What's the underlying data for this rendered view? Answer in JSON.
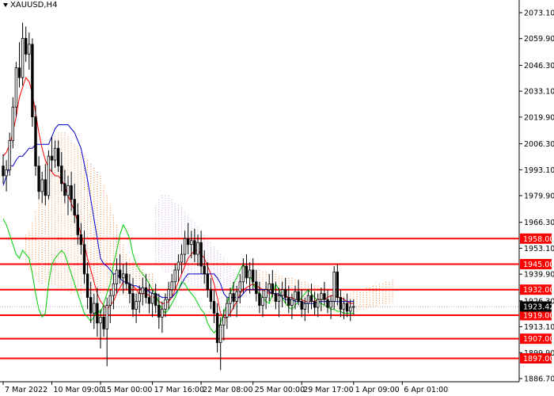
{
  "chart_data": {
    "type": "candlestick",
    "title": "XAUUSD,H4",
    "ylim": [
      1886.7,
      2080
    ],
    "y_ticks": [
      "2073.10",
      "2059.90",
      "2046.30",
      "2033.10",
      "2019.90",
      "2006.30",
      "1993.10",
      "1979.90",
      "1966.30",
      "1953.10",
      "1939.90",
      "1926.30",
      "1913.10",
      "1899.90",
      "1886.70"
    ],
    "x_ticks": [
      {
        "label": "7 Mar 2022",
        "index": 0
      },
      {
        "label": "10 Mar 09:00",
        "index": 15
      },
      {
        "label": "15 Mar 00:00",
        "index": 30
      },
      {
        "label": "17 Mar 16:00",
        "index": 46
      },
      {
        "label": "22 Mar 08:00",
        "index": 61
      },
      {
        "label": "25 Mar 00:00",
        "index": 77
      },
      {
        "label": "29 Mar 17:00",
        "index": 92
      },
      {
        "label": "1 Apr 09:00",
        "index": 108
      },
      {
        "label": "6 Apr 01:00",
        "index": 123
      }
    ],
    "horizontal_levels": [
      {
        "label": "1958.00",
        "value": 1958.0,
        "color": "#ff0000"
      },
      {
        "label": "1945.00",
        "value": 1945.0,
        "color": "#ff0000"
      },
      {
        "label": "1932.00",
        "value": 1932.0,
        "color": "#ff0000"
      },
      {
        "label": "1919.00",
        "value": 1919.0,
        "color": "#ff0000"
      },
      {
        "label": "1907.00",
        "value": 1907.0,
        "color": "#ff0000"
      },
      {
        "label": "1897.00",
        "value": 1897.0,
        "color": "#ff0000"
      }
    ],
    "current_price": {
      "label": "1923.42",
      "value": 1923.42
    },
    "candles": [
      [
        1995,
        2001,
        1986,
        1990
      ],
      [
        1990,
        1998,
        1982,
        1993
      ],
      [
        1993,
        2012,
        1990,
        2008
      ],
      [
        2008,
        2030,
        2004,
        2025
      ],
      [
        2025,
        2048,
        2020,
        2045
      ],
      [
        2045,
        2058,
        2035,
        2040
      ],
      [
        2040,
        2068,
        2036,
        2060
      ],
      [
        2060,
        2066,
        2048,
        2052
      ],
      [
        2052,
        2063,
        2044,
        2057
      ],
      [
        2057,
        2060,
        2015,
        2020
      ],
      [
        2020,
        2026,
        1990,
        1995
      ],
      [
        1995,
        2000,
        1978,
        1982
      ],
      [
        1982,
        1992,
        1976,
        1988
      ],
      [
        1988,
        1996,
        1975,
        1980
      ],
      [
        1980,
        2003,
        1978,
        2000
      ],
      [
        2000,
        2010,
        1992,
        1998
      ],
      [
        1998,
        2008,
        1994,
        2004
      ],
      [
        2004,
        2008,
        1992,
        1995
      ],
      [
        1995,
        2002,
        1982,
        1986
      ],
      [
        1986,
        1993,
        1976,
        1980
      ],
      [
        1980,
        1990,
        1970,
        1985
      ],
      [
        1985,
        1992,
        1972,
        1978
      ],
      [
        1978,
        1986,
        1966,
        1970
      ],
      [
        1970,
        1976,
        1955,
        1960
      ],
      [
        1960,
        1966,
        1950,
        1955
      ],
      [
        1955,
        1962,
        1935,
        1940
      ],
      [
        1940,
        1946,
        1922,
        1928
      ],
      [
        1928,
        1936,
        1915,
        1920
      ],
      [
        1920,
        1930,
        1912,
        1925
      ],
      [
        1925,
        1933,
        1908,
        1915
      ],
      [
        1915,
        1922,
        1902,
        1918
      ],
      [
        1918,
        1924,
        1908,
        1912
      ],
      [
        1912,
        1928,
        1893,
        1924
      ],
      [
        1924,
        1932,
        1915,
        1929
      ],
      [
        1929,
        1940,
        1922,
        1935
      ],
      [
        1935,
        1948,
        1930,
        1942
      ],
      [
        1942,
        1950,
        1935,
        1938
      ],
      [
        1938,
        1945,
        1930,
        1940
      ],
      [
        1940,
        1946,
        1932,
        1935
      ],
      [
        1935,
        1940,
        1925,
        1930
      ],
      [
        1930,
        1938,
        1918,
        1922
      ],
      [
        1922,
        1930,
        1915,
        1926
      ],
      [
        1926,
        1934,
        1920,
        1930
      ],
      [
        1930,
        1938,
        1924,
        1933
      ],
      [
        1933,
        1940,
        1925,
        1928
      ],
      [
        1928,
        1935,
        1920,
        1925
      ],
      [
        1925,
        1932,
        1918,
        1930
      ],
      [
        1930,
        1935,
        1920,
        1924
      ],
      [
        1924,
        1930,
        1912,
        1918
      ],
      [
        1918,
        1926,
        1910,
        1922
      ],
      [
        1922,
        1930,
        1918,
        1927
      ],
      [
        1927,
        1936,
        1922,
        1932
      ],
      [
        1932,
        1940,
        1928,
        1936
      ],
      [
        1936,
        1945,
        1932,
        1942
      ],
      [
        1942,
        1950,
        1936,
        1946
      ],
      [
        1946,
        1955,
        1940,
        1950
      ],
      [
        1950,
        1962,
        1945,
        1958
      ],
      [
        1958,
        1966,
        1950,
        1955
      ],
      [
        1955,
        1962,
        1948,
        1957
      ],
      [
        1957,
        1963,
        1946,
        1950
      ],
      [
        1950,
        1960,
        1944,
        1956
      ],
      [
        1956,
        1962,
        1940,
        1944
      ],
      [
        1944,
        1952,
        1935,
        1940
      ],
      [
        1940,
        1946,
        1928,
        1932
      ],
      [
        1932,
        1938,
        1922,
        1926
      ],
      [
        1926,
        1932,
        1915,
        1920
      ],
      [
        1920,
        1925,
        1900,
        1905
      ],
      [
        1905,
        1918,
        1891,
        1914
      ],
      [
        1914,
        1922,
        1906,
        1918
      ],
      [
        1918,
        1928,
        1912,
        1925
      ],
      [
        1925,
        1933,
        1918,
        1930
      ],
      [
        1930,
        1936,
        1922,
        1926
      ],
      [
        1926,
        1934,
        1918,
        1931
      ],
      [
        1931,
        1940,
        1925,
        1936
      ],
      [
        1936,
        1948,
        1930,
        1944
      ],
      [
        1944,
        1950,
        1935,
        1938
      ],
      [
        1938,
        1946,
        1930,
        1942
      ],
      [
        1942,
        1948,
        1932,
        1936
      ],
      [
        1936,
        1942,
        1926,
        1930
      ],
      [
        1930,
        1936,
        1920,
        1924
      ],
      [
        1924,
        1932,
        1918,
        1928
      ],
      [
        1928,
        1936,
        1922,
        1932
      ],
      [
        1932,
        1940,
        1926,
        1935
      ],
      [
        1935,
        1942,
        1928,
        1930
      ],
      [
        1930,
        1936,
        1922,
        1926
      ],
      [
        1926,
        1933,
        1918,
        1929
      ],
      [
        1929,
        1936,
        1923,
        1932
      ],
      [
        1932,
        1938,
        1925,
        1928
      ],
      [
        1928,
        1934,
        1920,
        1924
      ],
      [
        1924,
        1930,
        1917,
        1927
      ],
      [
        1927,
        1934,
        1922,
        1931
      ],
      [
        1931,
        1937,
        1924,
        1926
      ],
      [
        1926,
        1932,
        1918,
        1922
      ],
      [
        1922,
        1928,
        1916,
        1925
      ],
      [
        1925,
        1932,
        1920,
        1929
      ],
      [
        1929,
        1935,
        1922,
        1926
      ],
      [
        1926,
        1931,
        1919,
        1923
      ],
      [
        1923,
        1930,
        1918,
        1927
      ],
      [
        1927,
        1933,
        1921,
        1930
      ],
      [
        1930,
        1936,
        1924,
        1927
      ],
      [
        1927,
        1932,
        1920,
        1923
      ],
      [
        1923,
        1929,
        1917,
        1926
      ],
      [
        1926,
        1944,
        1922,
        1941
      ],
      [
        1941,
        1945,
        1924,
        1928
      ],
      [
        1928,
        1932,
        1918,
        1922
      ],
      [
        1922,
        1928,
        1917,
        1925
      ],
      [
        1925,
        1930,
        1918,
        1921
      ],
      [
        1921,
        1927,
        1916,
        1923
      ],
      [
        1923,
        1927,
        1919,
        1923.42
      ]
    ],
    "lines": [
      {
        "color": "#ff0000",
        "values": [
          2000,
          2002,
          2006,
          2012,
          2020,
          2030,
          2035,
          2040,
          2038,
          2032,
          2022,
          2012,
          2004,
          1998,
          1994,
          1992,
          1990,
          1990,
          1988,
          1985,
          1980,
          1976,
          1972,
          1966,
          1960,
          1955,
          1948,
          1942,
          1936,
          1930,
          1926,
          1924,
          1922,
          1924,
          1926,
          1930,
          1933,
          1936,
          1936,
          1935,
          1934,
          1932,
          1930,
          1930,
          1930,
          1929,
          1928,
          1928,
          1926,
          1925,
          1925,
          1926,
          1928,
          1932,
          1936,
          1940,
          1944,
          1948,
          1950,
          1952,
          1952,
          1950,
          1948,
          1944,
          1940,
          1935,
          1928,
          1920,
          1917,
          1918,
          1920,
          1923,
          1926,
          1930,
          1932,
          1933,
          1934,
          1935,
          1934,
          1933,
          1932,
          1931,
          1930,
          1930,
          1930,
          1929,
          1929,
          1929,
          1928,
          1928,
          1927,
          1927,
          1927,
          1926,
          1926,
          1926,
          1926,
          1927,
          1927,
          1927,
          1928,
          1929,
          1929,
          1928,
          1928,
          1927,
          1926,
          1925,
          1925
        ]
      },
      {
        "color": "#0000cc",
        "values": [
          1985,
          1990,
          1995,
          1995,
          1998,
          2000,
          2000,
          2002,
          2004,
          2004,
          2006,
          2006,
          2006,
          2006,
          2006,
          2010,
          2014,
          2016,
          2016,
          2016,
          2016,
          2014,
          2012,
          2008,
          2004,
          1996,
          1988,
          1978,
          1968,
          1958,
          1948,
          1945,
          1944,
          1942,
          1940,
          1940,
          1938,
          1936,
          1936,
          1935,
          1934,
          1934,
          1933,
          1932,
          1932,
          1931,
          1930,
          1930,
          1929,
          1928,
          1928,
          1928,
          1928,
          1930,
          1932,
          1935,
          1938,
          1940,
          1940,
          1940,
          1940,
          1940,
          1940,
          1940,
          1940,
          1940,
          1938,
          1935,
          1930,
          1928,
          1928,
          1928,
          1928,
          1928,
          1930,
          1932,
          1932,
          1932,
          1932,
          1932,
          1932,
          1932,
          1931,
          1930,
          1930,
          1930,
          1928,
          1927,
          1927,
          1927,
          1926,
          1926,
          1926,
          1925,
          1925,
          1925,
          1925,
          1926,
          1926,
          1926,
          1926,
          1926,
          1926,
          1926,
          1926,
          1926,
          1926,
          1926,
          1926
        ]
      },
      {
        "color": "#00cc00",
        "values": [
          1968,
          1965,
          1960,
          1955,
          1950,
          1948,
          1952,
          1950,
          1948,
          1940,
          1930,
          1922,
          1918,
          1920,
          1935,
          1945,
          1948,
          1950,
          1952,
          1950,
          1945,
          1940,
          1935,
          1930,
          1925,
          1920,
          1918,
          1916,
          1918,
          1922,
          1920,
          1925,
          1930,
          1935,
          1945,
          1952,
          1960,
          1965,
          1962,
          1958,
          1950,
          1945,
          1942,
          1940,
          1938,
          1935,
          1932,
          1930,
          1925,
          1922,
          1920,
          1922,
          1925,
          1928,
          1932,
          1936,
          1935,
          1932,
          1930,
          1928,
          1925,
          1922,
          1920,
          1915,
          1912,
          1910,
          1912,
          1915,
          1920,
          1925,
          1930,
          1935,
          1938,
          1942,
          1945,
          1942,
          1940,
          1935,
          1932,
          1930,
          1928,
          1926,
          1925,
          1930,
          1935,
          1932,
          1928,
          1925,
          1923,
          1922,
          1924,
          1926,
          1928,
          1930,
          1932,
          1930,
          1928,
          1926,
          1925,
          1924,
          1923,
          1922,
          1922,
          1921,
          1921,
          1920,
          1920,
          1920,
          1920
        ]
      }
    ],
    "clouds": [
      {
        "color": "#f08030",
        "start": 7,
        "values_a": [
          1960,
          1962,
          1966,
          1972,
          1980,
          1990,
          1998,
          2004,
          2008,
          2010,
          2012,
          2012,
          2012,
          2010,
          2008,
          2006,
          2004,
          2002,
          2000,
          1998,
          1996,
          1994,
          1992,
          1990,
          1985,
          1980,
          1975,
          1970,
          1965,
          1960,
          1955,
          1950,
          1948,
          1946,
          1944,
          1944,
          1942,
          1940,
          1940,
          1940
        ],
        "values_b": [
          1945,
          1942,
          1940,
          1938,
          1935,
          1935,
          1935,
          1934,
          1934,
          1934,
          1933,
          1932,
          1932,
          1931,
          1930,
          1930,
          1930,
          1930,
          1930,
          1930,
          1930,
          1930,
          1930,
          1930,
          1930,
          1929,
          1929,
          1929,
          1929,
          1929,
          1929,
          1928,
          1928,
          1928,
          1928,
          1928,
          1928,
          1928,
          1928,
          1928
        ]
      },
      {
        "color": "#c8a0e0",
        "start": 47,
        "values_a": [
          1975,
          1978,
          1980,
          1980,
          1980,
          1978,
          1976,
          1975,
          1974,
          1972,
          1970,
          1968,
          1966,
          1964,
          1962,
          1960,
          1958,
          1956,
          1954,
          1952,
          1950,
          1948,
          1946,
          1944,
          1942,
          1940,
          1938,
          1936,
          1935,
          1934
        ],
        "values_b": [
          1945,
          1944,
          1942,
          1940,
          1940,
          1938,
          1938,
          1936,
          1936,
          1935,
          1935,
          1934,
          1934,
          1933,
          1933,
          1932,
          1932,
          1931,
          1931,
          1930,
          1930,
          1930,
          1930,
          1929,
          1929,
          1929,
          1928,
          1928,
          1928,
          1928
        ]
      },
      {
        "color": "#f08030",
        "start": 78,
        "values_a": [
          1942,
          1942,
          1941,
          1941,
          1940,
          1940,
          1940,
          1939,
          1939,
          1938,
          1938,
          1938,
          1937,
          1937,
          1936,
          1936,
          1935,
          1935,
          1934,
          1934,
          1933,
          1933,
          1932,
          1932,
          1931,
          1931,
          1930,
          1930,
          1930,
          1930,
          1931,
          1931,
          1932,
          1932,
          1933,
          1933,
          1934,
          1934,
          1935,
          1935,
          1936,
          1936,
          1937
        ],
        "values_b": [
          1928,
          1928,
          1927,
          1927,
          1926,
          1926,
          1926,
          1925,
          1925,
          1925,
          1924,
          1924,
          1924,
          1923,
          1923,
          1923,
          1922,
          1922,
          1922,
          1921,
          1921,
          1921,
          1921,
          1920,
          1920,
          1920,
          1920,
          1920,
          1920,
          1921,
          1921,
          1921,
          1922,
          1922,
          1922,
          1923,
          1923,
          1923,
          1924,
          1924,
          1924,
          1925,
          1925
        ]
      }
    ]
  }
}
